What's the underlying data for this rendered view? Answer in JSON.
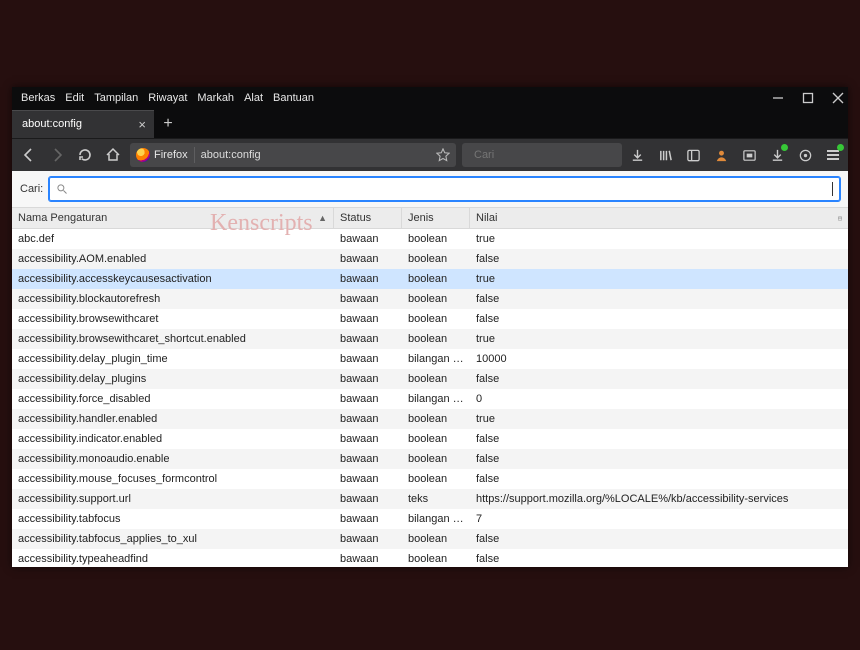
{
  "watermark": "Kenscripts",
  "menubar": [
    "Berkas",
    "Edit",
    "Tampilan",
    "Riwayat",
    "Markah",
    "Alat",
    "Bantuan"
  ],
  "tab": {
    "title": "about:config"
  },
  "urlbar": {
    "brand": "Firefox",
    "address": "about:config"
  },
  "searchbar": {
    "placeholder": "Cari"
  },
  "pref_search": {
    "label": "Cari:",
    "value": ""
  },
  "columns": {
    "name": "Nama Pengaturan",
    "status": "Status",
    "type": "Jenis",
    "value": "Nilai"
  },
  "rows": [
    {
      "name": "abc.def",
      "status": "bawaan",
      "type": "boolean",
      "value": "true",
      "hi": false
    },
    {
      "name": "accessibility.AOM.enabled",
      "status": "bawaan",
      "type": "boolean",
      "value": "false",
      "hi": false
    },
    {
      "name": "accessibility.accesskeycausesactivation",
      "status": "bawaan",
      "type": "boolean",
      "value": "true",
      "hi": true
    },
    {
      "name": "accessibility.blockautorefresh",
      "status": "bawaan",
      "type": "boolean",
      "value": "false",
      "hi": false
    },
    {
      "name": "accessibility.browsewithcaret",
      "status": "bawaan",
      "type": "boolean",
      "value": "false",
      "hi": false
    },
    {
      "name": "accessibility.browsewithcaret_shortcut.enabled",
      "status": "bawaan",
      "type": "boolean",
      "value": "true",
      "hi": false
    },
    {
      "name": "accessibility.delay_plugin_time",
      "status": "bawaan",
      "type": "bilangan bulat",
      "value": "10000",
      "hi": false
    },
    {
      "name": "accessibility.delay_plugins",
      "status": "bawaan",
      "type": "boolean",
      "value": "false",
      "hi": false
    },
    {
      "name": "accessibility.force_disabled",
      "status": "bawaan",
      "type": "bilangan bulat",
      "value": "0",
      "hi": false
    },
    {
      "name": "accessibility.handler.enabled",
      "status": "bawaan",
      "type": "boolean",
      "value": "true",
      "hi": false
    },
    {
      "name": "accessibility.indicator.enabled",
      "status": "bawaan",
      "type": "boolean",
      "value": "false",
      "hi": false
    },
    {
      "name": "accessibility.monoaudio.enable",
      "status": "bawaan",
      "type": "boolean",
      "value": "false",
      "hi": false
    },
    {
      "name": "accessibility.mouse_focuses_formcontrol",
      "status": "bawaan",
      "type": "boolean",
      "value": "false",
      "hi": false
    },
    {
      "name": "accessibility.support.url",
      "status": "bawaan",
      "type": "teks",
      "value": "https://support.mozilla.org/%LOCALE%/kb/accessibility-services",
      "hi": false
    },
    {
      "name": "accessibility.tabfocus",
      "status": "bawaan",
      "type": "bilangan bulat",
      "value": "7",
      "hi": false
    },
    {
      "name": "accessibility.tabfocus_applies_to_xul",
      "status": "bawaan",
      "type": "boolean",
      "value": "false",
      "hi": false
    },
    {
      "name": "accessibility.typeaheadfind",
      "status": "bawaan",
      "type": "boolean",
      "value": "false",
      "hi": false
    }
  ]
}
